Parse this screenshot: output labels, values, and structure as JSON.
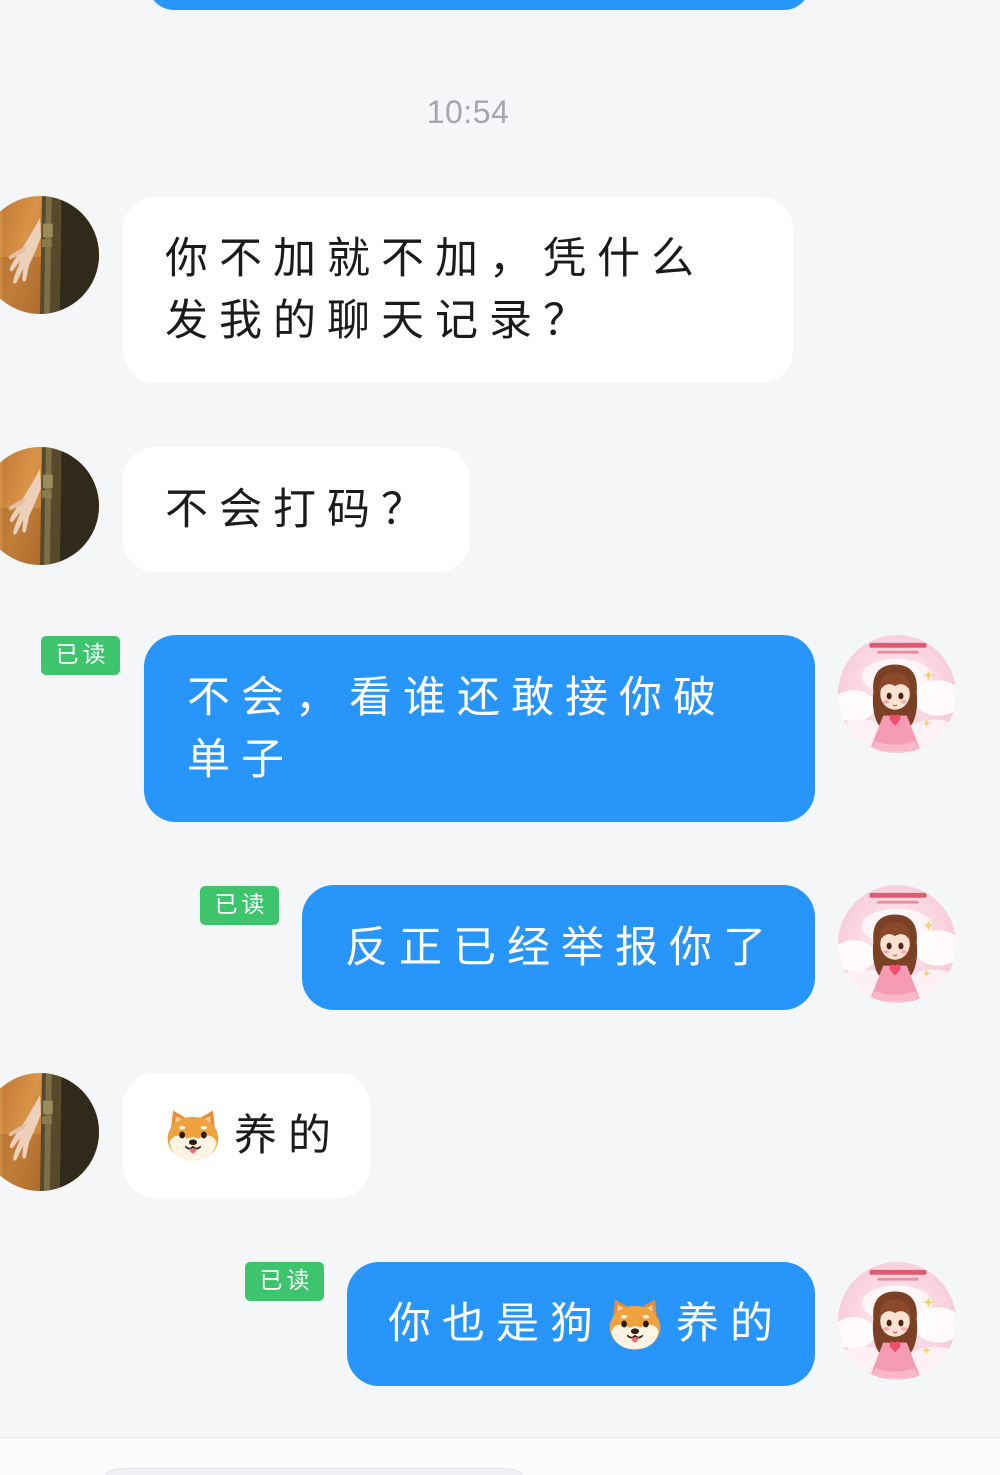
{
  "conversation": {
    "timestamp": "10:54",
    "messages": [
      {
        "direction": "received",
        "text": "你不加就不加，凭什么发我的聊天记录？"
      },
      {
        "direction": "received",
        "text": "不会打码？"
      },
      {
        "direction": "sent",
        "read_status": "已读",
        "text": "不会，看谁还敢接你破单子"
      },
      {
        "direction": "sent",
        "read_status": "已读",
        "text": "反正已经举报你了"
      },
      {
        "direction": "received",
        "content": [
          {
            "type": "emoji",
            "icon": "dog-face-icon"
          },
          {
            "type": "text",
            "value": "养的"
          }
        ]
      },
      {
        "direction": "sent",
        "read_status": "已读",
        "content": [
          {
            "type": "text",
            "value": "你也是狗"
          },
          {
            "type": "emoji",
            "icon": "dog-face-icon"
          },
          {
            "type": "text",
            "value": "养的"
          }
        ]
      }
    ]
  },
  "icons": {
    "contact_avatar": "contact-avatar",
    "my_avatar": "my-avatar",
    "emoji": "dog-face-icon"
  },
  "colors": {
    "background": "#f5f6f8",
    "sent_bubble": "#2795fa",
    "received_bubble": "#ffffff",
    "read_badge": "#3ec46d",
    "timestamp_text": "#a3a6ab",
    "received_text": "#1b1b1b",
    "sent_text": "#ffffff"
  }
}
